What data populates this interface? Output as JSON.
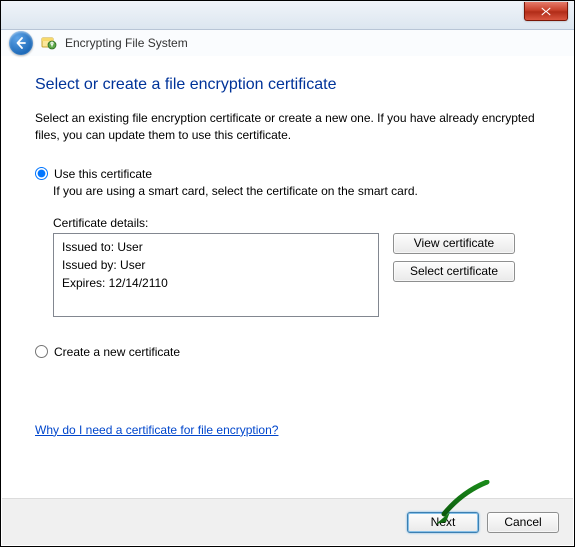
{
  "window": {
    "title": "Encrypting File System"
  },
  "close_tooltip": "Close",
  "headline": "Select or create a file encryption certificate",
  "intro": "Select an existing file encryption certificate or create a new one. If you have already encrypted files, you can update them to use this certificate.",
  "option_use": {
    "label": "Use this certificate",
    "note": "If you are using a smart card, select the certificate on the smart card.",
    "checked": true
  },
  "details": {
    "label": "Certificate details:",
    "issued_to": "Issued to: User",
    "issued_by": "Issued by: User",
    "expires": "Expires: 12/14/2110"
  },
  "buttons": {
    "view": "View certificate",
    "select": "Select certificate",
    "next": "Next",
    "cancel": "Cancel"
  },
  "option_create": {
    "label": "Create a new certificate",
    "checked": false
  },
  "help_link": "Why do I need a certificate for file encryption?"
}
